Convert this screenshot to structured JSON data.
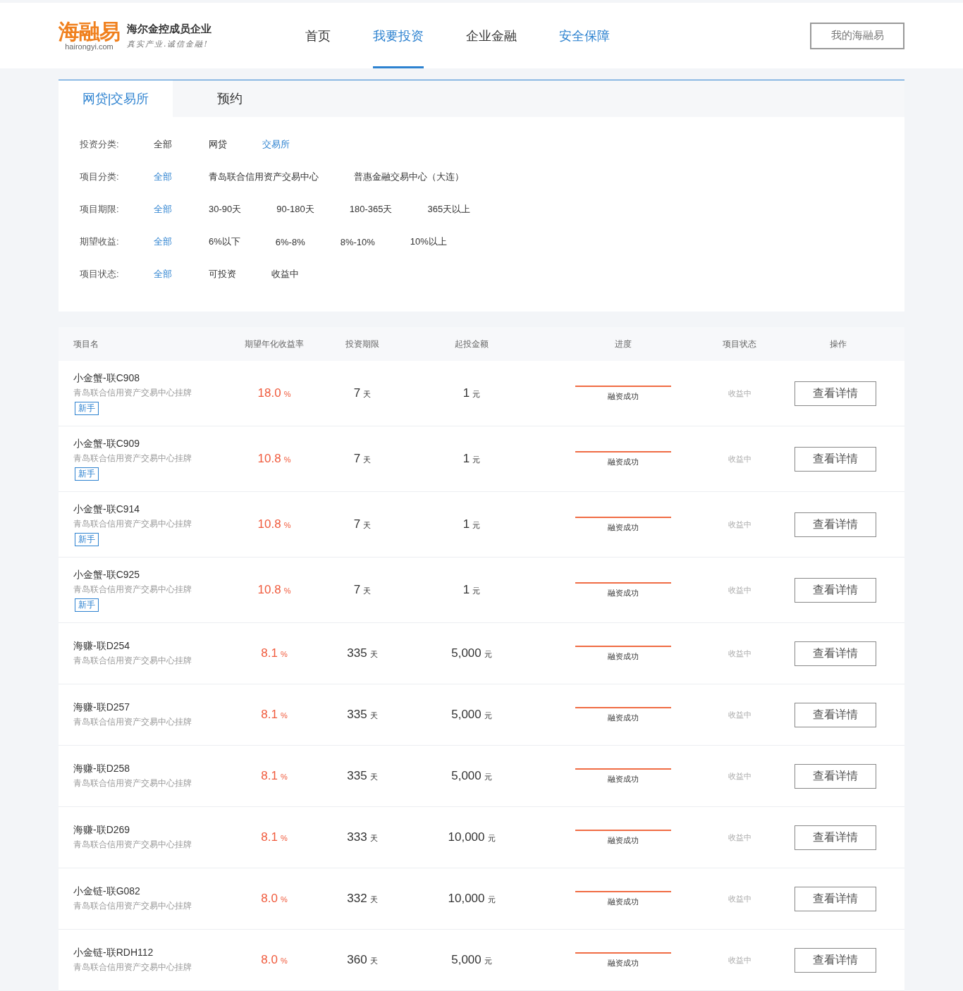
{
  "header": {
    "logo": {
      "mark": "海融易",
      "domain": "hairongyi.com",
      "tagline": "海尔金控成员企业",
      "slogan": "真实产业.诚信金融!"
    },
    "nav": [
      {
        "label": "首页",
        "selected": false,
        "highlighted": false
      },
      {
        "label": "我要投资",
        "selected": true,
        "highlighted": false
      },
      {
        "label": "企业金融",
        "selected": false,
        "highlighted": false
      },
      {
        "label": "安全保障",
        "selected": false,
        "highlighted": true
      }
    ],
    "account_button": "我的海融易"
  },
  "tabs": [
    {
      "label": "网贷|交易所",
      "selected": true
    },
    {
      "label": "预约",
      "selected": false
    }
  ],
  "filters": [
    {
      "label": "投资分类:",
      "options": [
        {
          "label": "全部",
          "selected": false
        },
        {
          "label": "网贷",
          "selected": false
        },
        {
          "label": "交易所",
          "selected": true
        }
      ]
    },
    {
      "label": "项目分类:",
      "options": [
        {
          "label": "全部",
          "selected": true
        },
        {
          "label": "青岛联合信用资产交易中心",
          "selected": false
        },
        {
          "label": "普惠金融交易中心（大连）",
          "selected": false
        }
      ]
    },
    {
      "label": "项目期限:",
      "options": [
        {
          "label": "全部",
          "selected": true
        },
        {
          "label": "30-90天",
          "selected": false
        },
        {
          "label": "90-180天",
          "selected": false
        },
        {
          "label": "180-365天",
          "selected": false
        },
        {
          "label": "365天以上",
          "selected": false
        }
      ]
    },
    {
      "label": "期望收益:",
      "options": [
        {
          "label": "全部",
          "selected": true
        },
        {
          "label": "6%以下",
          "selected": false
        },
        {
          "label": "6%-8%",
          "selected": false
        },
        {
          "label": "8%-10%",
          "selected": false
        },
        {
          "label": "10%以上",
          "selected": false
        }
      ]
    },
    {
      "label": "项目状态:",
      "options": [
        {
          "label": "全部",
          "selected": true
        },
        {
          "label": "可投资",
          "selected": false
        },
        {
          "label": "收益中",
          "selected": false
        }
      ]
    }
  ],
  "table": {
    "columns": [
      "项目名",
      "期望年化收益率",
      "投资期限",
      "起投金额",
      "进度",
      "项目状态",
      "操作"
    ],
    "rows": [
      {
        "name": "小金蟹-联C908",
        "exchange": "青岛联合信用资产交易中心挂牌",
        "badge": "新手",
        "rate": "18.0",
        "rate_unit": "%",
        "term": "7",
        "term_unit": "天",
        "amount": "1",
        "amount_unit": "元",
        "level": 1,
        "progress_label": "融资成功",
        "status": "收益中",
        "action": "查看详情"
      },
      {
        "name": "小金蟹-联C909",
        "exchange": "青岛联合信用资产交易中心挂牌",
        "badge": "新手",
        "rate": "10.8",
        "rate_unit": "%",
        "term": "7",
        "term_unit": "天",
        "amount": "1",
        "amount_unit": "元",
        "level": 1,
        "progress_label": "融资成功",
        "status": "收益中",
        "action": "查看详情"
      },
      {
        "name": "小金蟹-联C914",
        "exchange": "青岛联合信用资产交易中心挂牌",
        "badge": "新手",
        "rate": "10.8",
        "rate_unit": "%",
        "term": "7",
        "term_unit": "天",
        "amount": "1",
        "amount_unit": "元",
        "level": 1,
        "progress_label": "融资成功",
        "status": "收益中",
        "action": "查看详情"
      },
      {
        "name": "小金蟹-联C925",
        "exchange": "青岛联合信用资产交易中心挂牌",
        "badge": "新手",
        "rate": "10.8",
        "rate_unit": "%",
        "term": "7",
        "term_unit": "天",
        "amount": "1",
        "amount_unit": "元",
        "level": 1,
        "progress_label": "融资成功",
        "status": "收益中",
        "action": "查看详情"
      },
      {
        "name": "海赚-联D254",
        "exchange": "青岛联合信用资产交易中心挂牌",
        "rate": "8.1",
        "rate_unit": "%",
        "term": "335",
        "term_unit": "天",
        "amount": "5,000",
        "amount_unit": "元",
        "level": 1,
        "progress_label": "融资成功",
        "status": "收益中",
        "action": "查看详情"
      },
      {
        "name": "海赚-联D257",
        "exchange": "青岛联合信用资产交易中心挂牌",
        "rate": "8.1",
        "rate_unit": "%",
        "term": "335",
        "term_unit": "天",
        "amount": "5,000",
        "amount_unit": "元",
        "level": 1,
        "progress_label": "融资成功",
        "status": "收益中",
        "action": "查看详情"
      },
      {
        "name": "海赚-联D258",
        "exchange": "青岛联合信用资产交易中心挂牌",
        "rate": "8.1",
        "rate_unit": "%",
        "term": "335",
        "term_unit": "天",
        "amount": "5,000",
        "amount_unit": "元",
        "level": 1,
        "progress_label": "融资成功",
        "status": "收益中",
        "action": "查看详情"
      },
      {
        "name": "海赚-联D269",
        "exchange": "青岛联合信用资产交易中心挂牌",
        "rate": "8.1",
        "rate_unit": "%",
        "term": "333",
        "term_unit": "天",
        "amount": "10,000",
        "amount_unit": "元",
        "level": 1,
        "progress_label": "融资成功",
        "status": "收益中",
        "action": "查看详情"
      },
      {
        "name": "小金链-联G082",
        "exchange": "青岛联合信用资产交易中心挂牌",
        "rate": "8.0",
        "rate_unit": "%",
        "term": "332",
        "term_unit": "天",
        "amount": "10,000",
        "amount_unit": "元",
        "level": 1,
        "progress_label": "融资成功",
        "status": "收益中",
        "action": "查看详情"
      },
      {
        "name": "小金链-联RDH112",
        "exchange": "青岛联合信用资产交易中心挂牌",
        "rate": "8.0",
        "rate_unit": "%",
        "term": "360",
        "term_unit": "天",
        "amount": "5,000",
        "amount_unit": "元",
        "level": 1,
        "progress_label": "融资成功",
        "status": "收益中",
        "action": "查看详情"
      }
    ]
  }
}
